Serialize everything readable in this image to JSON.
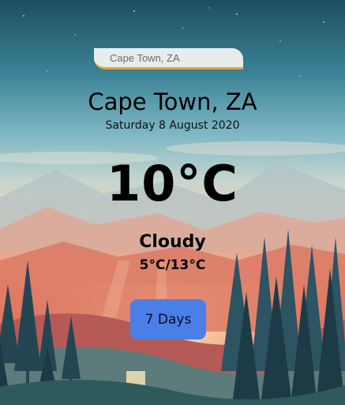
{
  "search": {
    "placeholder": "Cape Town, ZA"
  },
  "location": {
    "city": "Cape Town, ZA",
    "date": "Saturday 8 August 2020"
  },
  "weather": {
    "temperature": "10°C",
    "condition": "Cloudy",
    "range": "5°C/13°C"
  },
  "buttons": {
    "forecast_label": "7 Days"
  },
  "colors": {
    "accent": "#e6a531",
    "button": "#4a7fe8"
  }
}
